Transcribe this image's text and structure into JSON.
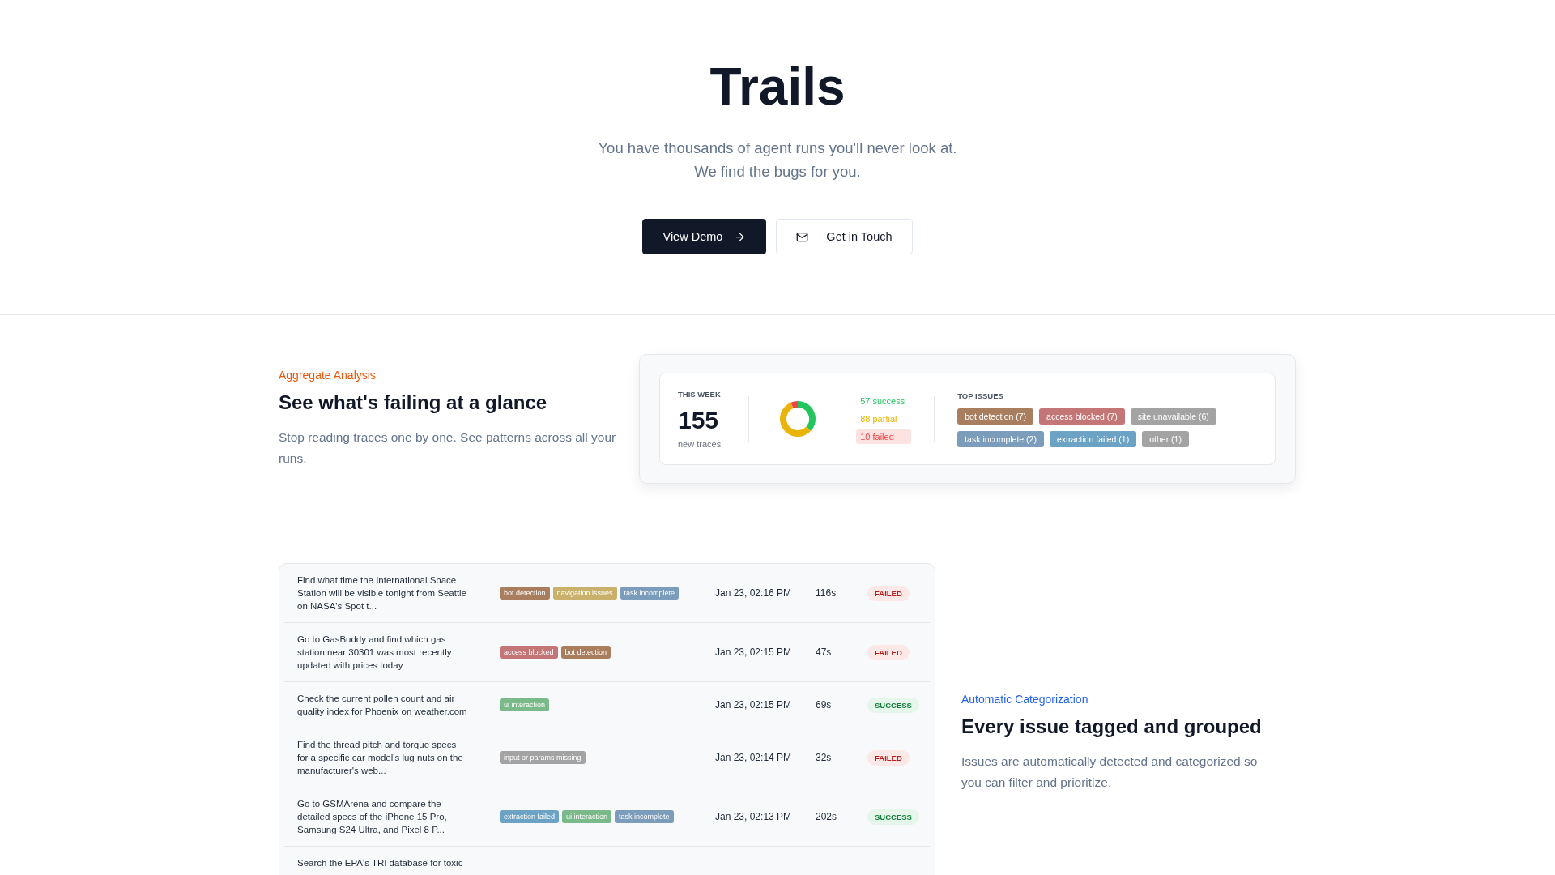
{
  "hero": {
    "title": "Trails",
    "subtitle_lines": [
      "You have thousands of agent runs you'll never look at.",
      "We find the bugs for you."
    ],
    "buttons": [
      {
        "kind": "primary",
        "label": "View Demo"
      },
      {
        "kind": "secondary",
        "label": "Get in Touch"
      }
    ]
  },
  "aggregate": {
    "eyebrow": "Aggregate Analysis",
    "heading": "See what's failing at a glance",
    "body": "Stop reading traces one by one. See patterns across all your runs.",
    "stats": {
      "period_label": "THIS WEEK",
      "count": "155",
      "count_label": "new traces",
      "chart_data": {
        "type": "donut",
        "values": [
          36.8,
          56.8,
          6.4
        ]
      },
      "legend": [
        {
          "label": "57 success",
          "color": "#22c55e",
          "selected": false
        },
        {
          "label": "88 partial",
          "color": "#eab308",
          "selected": false
        },
        {
          "label": "10 failed",
          "color": "#ef4444",
          "selected": true
        }
      ],
      "issues_label": "TOP ISSUES",
      "issues": [
        {
          "label": "bot detection (7)",
          "color": "#a97e5f"
        },
        {
          "label": "access blocked (7)",
          "color": "#c47575"
        },
        {
          "label": "site unavailable (6)",
          "color": "#a3a3a3"
        },
        {
          "label": "task incomplete (2)",
          "color": "#7b9cba"
        },
        {
          "label": "extraction failed (1)",
          "color": "#6ca3c4"
        },
        {
          "label": "other (1)",
          "color": "#a3a3a3"
        }
      ]
    }
  },
  "categorization": {
    "eyebrow": "Automatic Categorization",
    "heading": "Every issue tagged and grouped",
    "body": "Issues are automatically detected and categorized so you can filter and prioritize.",
    "rows": [
      {
        "task": "Find what time the International Space Station will be visible tonight from Seattle on NASA's Spot t...",
        "tags": [
          {
            "label": "bot detection",
            "color": "#a97e5f"
          },
          {
            "label": "navigation issues",
            "color": "#c9b16c"
          },
          {
            "label": "task incomplete",
            "color": "#7b9cba"
          }
        ],
        "time": "Jan 23, 02:16 PM",
        "duration": "116s",
        "status": {
          "kind": "failed",
          "label": "FAILED"
        }
      },
      {
        "task": "Go to GasBuddy and find which gas station near 30301 was most recently updated with prices today",
        "tags": [
          {
            "label": "access blocked",
            "color": "#c47575"
          },
          {
            "label": "bot detection",
            "color": "#a97e5f"
          }
        ],
        "time": "Jan 23, 02:15 PM",
        "duration": "47s",
        "status": {
          "kind": "failed",
          "label": "FAILED"
        }
      },
      {
        "task": "Check the current pollen count and air quality index for Phoenix on weather.com",
        "tags": [
          {
            "label": "ui interaction",
            "color": "#7ab98a"
          }
        ],
        "time": "Jan 23, 02:15 PM",
        "duration": "69s",
        "status": {
          "kind": "success",
          "label": "SUCCESS"
        }
      },
      {
        "task": "Find the thread pitch and torque specs for a specific car model's lug nuts on the manufacturer's web...",
        "tags": [
          {
            "label": "input or params missing",
            "color": "#a3a3a3"
          }
        ],
        "time": "Jan 23, 02:14 PM",
        "duration": "32s",
        "status": {
          "kind": "failed",
          "label": "FAILED"
        }
      },
      {
        "task": "Go to GSMArena and compare the detailed specs of the iPhone 15 Pro, Samsung S24 Ultra, and Pixel 8 P...",
        "tags": [
          {
            "label": "extraction failed",
            "color": "#6ca3c4"
          },
          {
            "label": "ui interaction",
            "color": "#7ab98a"
          },
          {
            "label": "task incomplete",
            "color": "#7b9cba"
          }
        ],
        "time": "Jan 23, 02:13 PM",
        "duration": "202s",
        "status": {
          "kind": "success",
          "label": "SUCCESS"
        }
      },
      {
        "task": "Search the EPA's TRI database for toxic"
      }
    ]
  }
}
